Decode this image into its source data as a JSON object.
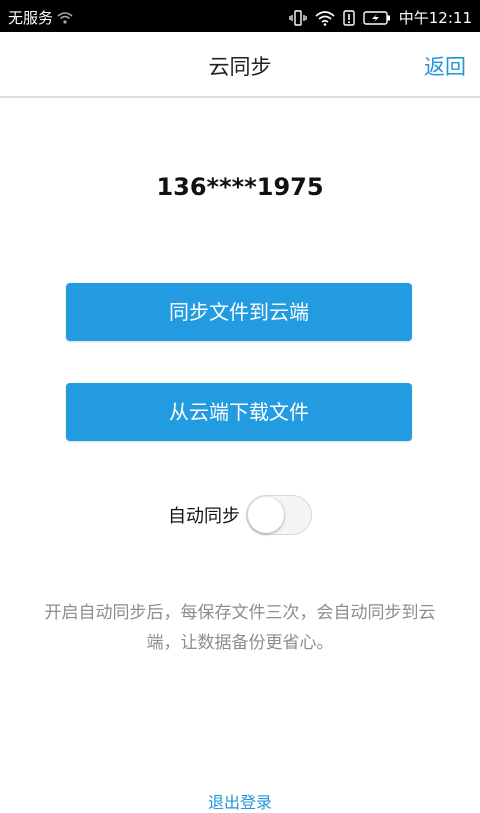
{
  "status_bar": {
    "carrier": "无服务",
    "time": "中午12:11",
    "icons": [
      "wifi-icon",
      "vibrate-icon",
      "signal-wifi-icon",
      "alert-icon",
      "battery-icon"
    ]
  },
  "nav": {
    "title": "云同步",
    "back_label": "返回"
  },
  "account": {
    "phone": "136****1975"
  },
  "actions": {
    "upload_label": "同步文件到云端",
    "download_label": "从云端下载文件"
  },
  "auto_sync": {
    "label": "自动同步",
    "enabled": false
  },
  "hint": "开启自动同步后，每保存文件三次，会自动同步到云端，让数据备份更省心。",
  "logout_label": "退出登录",
  "colors": {
    "accent": "#239be0",
    "link": "#2196d9",
    "hint_text": "#8d8d8d"
  }
}
